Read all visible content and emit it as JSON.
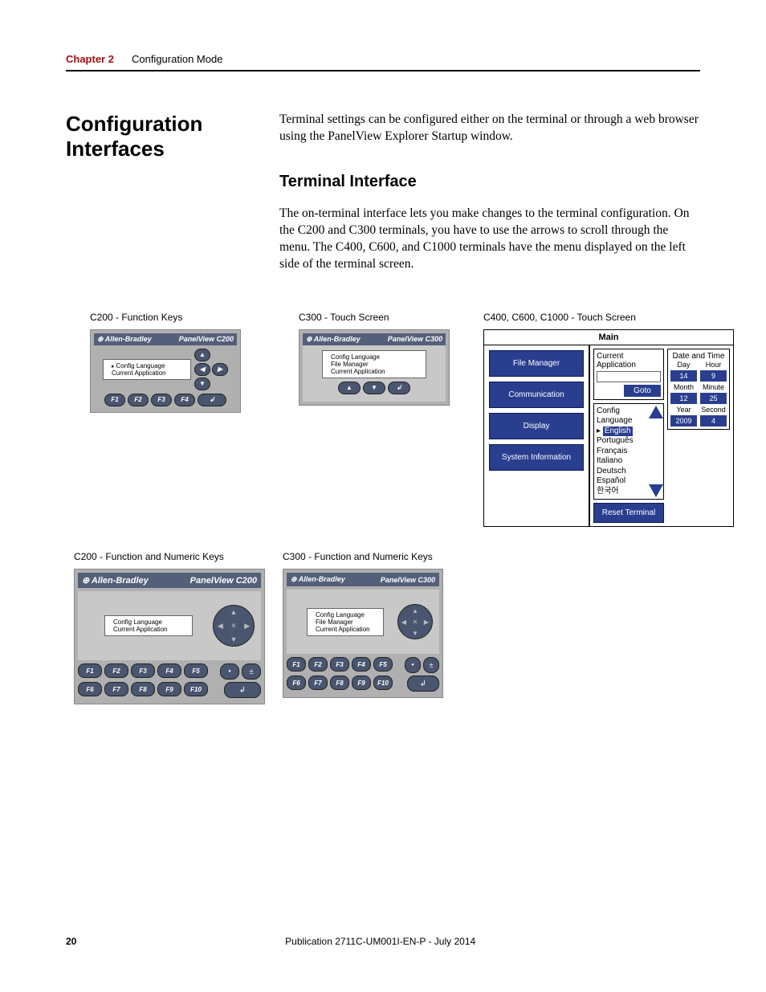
{
  "header": {
    "chapter": "Chapter 2",
    "title": "Configuration Mode"
  },
  "section": {
    "heading": "Configuration Interfaces"
  },
  "intro": "Terminal settings can be configured either on the terminal or through a web browser using the PanelView Explorer Startup window.",
  "sub_heading": "Terminal Interface",
  "sub_body": "The on-terminal interface lets you make changes to the terminal configuration. On the C200 and C300 terminals, you have to use the arrows to scroll through the menu. The C400, C600, and C1000 terminals have the menu displayed on the left side of the terminal screen.",
  "figs": {
    "c200_fk": "C200 - Function Keys",
    "c300_ts": "C300 - Touch Screen",
    "c400_ts": "C400, C600, C1000 - Touch Screen",
    "c200_fnk": "C200 - Function and Numeric Keys",
    "c300_fnk": "C300 - Function and Numeric Keys"
  },
  "panel": {
    "brand": "Allen-Bradley",
    "model_c200": "PanelView C200",
    "model_c300": "PanelView C300",
    "menu_config": "Config Language",
    "menu_file": "File Manager",
    "menu_app": "Current Application",
    "fkeys": [
      "F1",
      "F2",
      "F3",
      "F4"
    ],
    "fkeys5": [
      "F1",
      "F2",
      "F3",
      "F4",
      "F5"
    ],
    "fkeys10": [
      "F6",
      "F7",
      "F8",
      "F9",
      "F10"
    ]
  },
  "touch": {
    "title": "Main",
    "side": [
      "File Manager",
      "Communication",
      "Display",
      "System Information"
    ],
    "current_app_label": "Current Application",
    "goto": "Goto",
    "config_lang_label": "Config Language",
    "langs_sel": "English",
    "langs": [
      "Português",
      "Français",
      "Italiano",
      "Deutsch",
      "Español",
      "한국어"
    ],
    "reset": "Reset Terminal",
    "dt_label": "Date and Time",
    "dt": {
      "day_l": "Day",
      "hour_l": "Hour",
      "day": "14",
      "hour": "9",
      "mon_l": "Month",
      "min_l": "Minute",
      "mon": "12",
      "min": "25",
      "yr_l": "Year",
      "sec_l": "Second",
      "yr": "2009",
      "sec": "4"
    }
  },
  "footer": {
    "page": "20",
    "pub": "Publication 2711C-UM001I-EN-P - July 2014"
  }
}
